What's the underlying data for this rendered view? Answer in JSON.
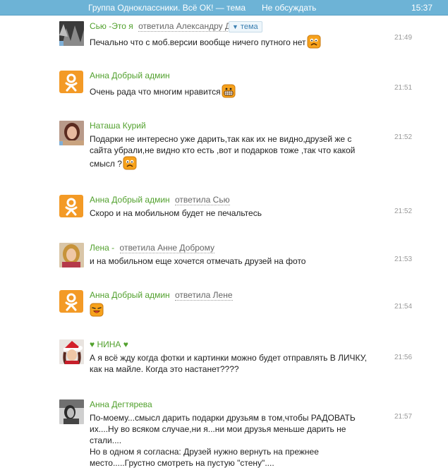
{
  "topbar": {
    "title": "Группа Одноклассники. Всё ОК! — тема",
    "mute": "Не обсуждать",
    "clock": "15:37"
  },
  "tema_button": {
    "arrow": "▼",
    "label": "тема"
  },
  "messages": [
    {
      "author": "Сью -Это я",
      "reply": "ответила Александру Д",
      "text": "Печально что с моб.версии вообще ничего путного нет",
      "time": "21:49",
      "avatar": "photo-dark",
      "smiley": "sad"
    },
    {
      "author": "Анна Добрый админ",
      "reply": "",
      "text": "Очень рада что многим нравится",
      "time": "21:51",
      "avatar": "ok-logo",
      "smiley": "grin"
    },
    {
      "author": "Наташа Курий",
      "reply": "",
      "text": "Подарки не интересно уже дарить,так как их не видно,друзей же с сайта убрали,не видно кто есть ,вот и подарков тоже ,так что какой смысл ?",
      "time": "21:52",
      "avatar": "photo-woman",
      "smiley": "sad"
    },
    {
      "author": "Анна Добрый админ",
      "reply": "ответила Сью",
      "text": "Скоро и на мобильном будет не печальтесь",
      "time": "21:52",
      "avatar": "ok-logo",
      "smiley": ""
    },
    {
      "author": "Лена -",
      "reply": "ответила Анне Доброму",
      "text": "и на мобильном еще хочется отмечать друзей на фото",
      "time": "21:53",
      "avatar": "photo-blonde",
      "smiley": ""
    },
    {
      "author": "Анна Добрый админ",
      "reply": "ответила Лене",
      "text": "",
      "time": "21:54",
      "avatar": "ok-logo",
      "smiley": "laugh"
    },
    {
      "author": "♥ НИНА ♥",
      "reply": "",
      "text": "А я всё жду когда фотки и картинки можно будет отправлять В ЛИЧКУ, как на майле. Когда это настанет????",
      "time": "21:56",
      "avatar": "photo-santa",
      "smiley": ""
    },
    {
      "author": "Анна Дегтярева",
      "reply": "",
      "text": "По-моему...смысл дарить подарки друзьям в том,чтобы РАДОВАТЬ их....Ну во всяком случае,ни я...ни мои друзья меньше дарить не стали....",
      "text2": "Но в одном я согласна: Друзей нужно вернуть на прежнее место.....Грустно смотреть на пустую \"стену\"....",
      "time": "21:57",
      "avatar": "photo-bw",
      "smiley": ""
    }
  ],
  "colors": {
    "topbar": "#6db3d6",
    "author": "#52a12e",
    "ok_orange": "#f39a26",
    "time": "#999999"
  }
}
